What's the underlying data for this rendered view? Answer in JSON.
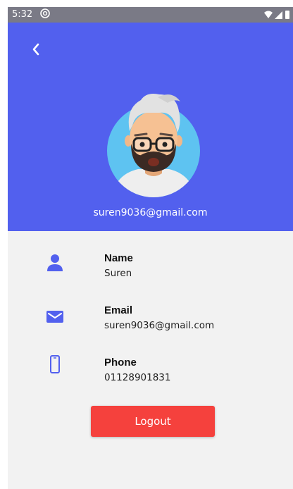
{
  "status_bar": {
    "time": "5:32",
    "icons": [
      "notification-icon",
      "wifi-icon",
      "signal-icon",
      "battery-icon"
    ]
  },
  "header": {
    "back_icon": "chevron-left-icon",
    "avatar_icon": "avatar-illustration",
    "email": "suren9036@gmail.com"
  },
  "profile": {
    "name": {
      "label": "Name",
      "value": "Suren",
      "icon": "person-icon"
    },
    "email": {
      "label": "Email",
      "value": "suren9036@gmail.com",
      "icon": "mail-icon"
    },
    "phone": {
      "label": "Phone",
      "value": "01128901831",
      "icon": "phone-icon"
    }
  },
  "logout": {
    "label": "Logout"
  },
  "colors": {
    "header_bg": "#5260ee",
    "accent_icon": "#5260ee",
    "logout_bg": "#f5413d",
    "body_bg": "#f2f2f2"
  }
}
